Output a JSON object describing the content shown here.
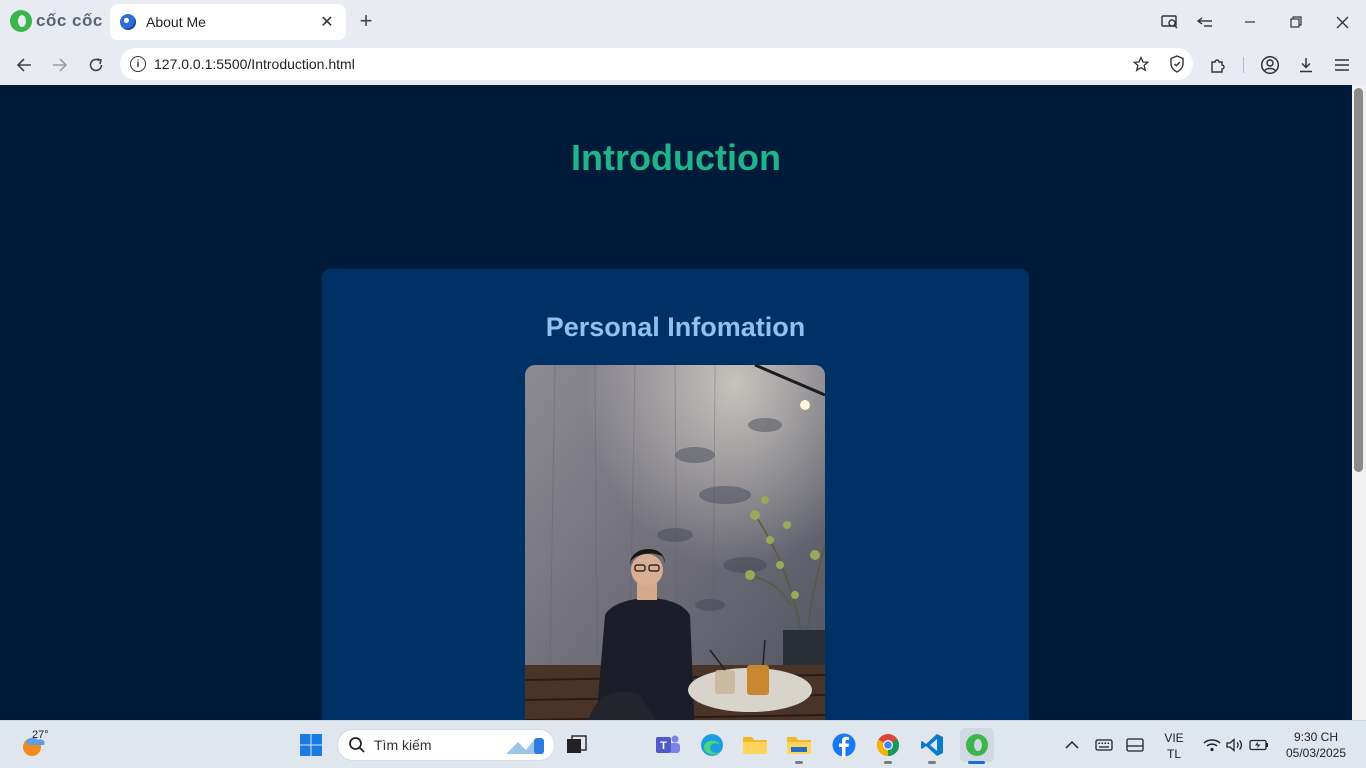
{
  "browser": {
    "brand": "cốc cốc",
    "tab_title": "About Me",
    "url": "127.0.0.1:5500/Introduction.html"
  },
  "page": {
    "title": "Introduction",
    "card_title": "Personal Infomation",
    "photo_description_icon": "portrait-photo"
  },
  "taskbar": {
    "temperature": "27°",
    "search_placeholder": "Tìm kiếm",
    "lang_line1": "VIE",
    "lang_line2": "TL",
    "time": "9:30 CH",
    "date": "05/03/2025"
  },
  "colors": {
    "page_bg": "#001b3a",
    "card_bg": "#003166",
    "title": "#1fb58a",
    "card_title": "#8ec2f3"
  }
}
